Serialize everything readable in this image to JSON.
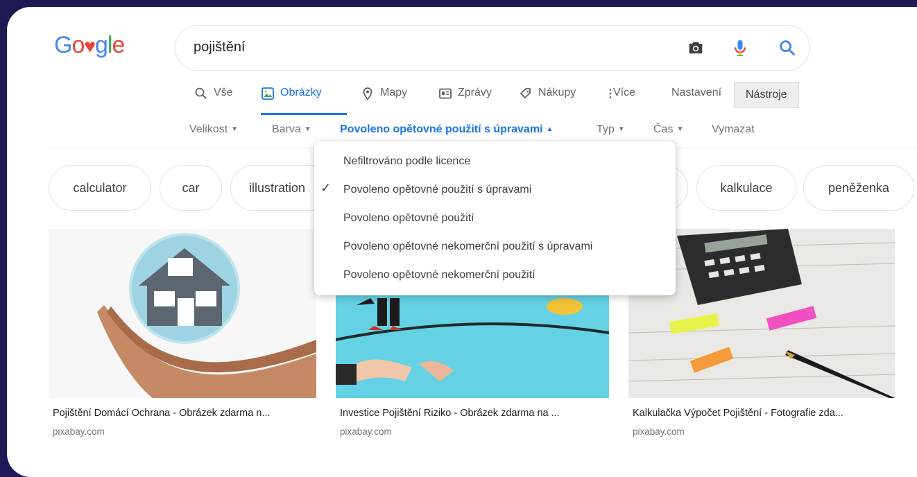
{
  "logo": {
    "letters": [
      "G",
      "o",
      "gle"
    ]
  },
  "search": {
    "query": "pojištění"
  },
  "tabs": [
    {
      "label": "Vše"
    },
    {
      "label": "Obrázky"
    },
    {
      "label": "Mapy"
    },
    {
      "label": "Zprávy"
    },
    {
      "label": "Nákupy"
    },
    {
      "label": "Více"
    },
    {
      "label": "Nastavení"
    },
    {
      "label": "Nástroje"
    }
  ],
  "filters": [
    {
      "label": "Velikost"
    },
    {
      "label": "Barva"
    },
    {
      "label": "Povoleno opětovné použití s úpravami"
    },
    {
      "label": "Typ"
    },
    {
      "label": "Čas"
    },
    {
      "label": "Vymazat"
    }
  ],
  "chips": [
    "calculator",
    "car",
    "illustration",
    "kalkulace",
    "peněženka"
  ],
  "dropdown": {
    "items": [
      "Nefiltrováno podle licence",
      "Povoleno opětovné použití s úpravami",
      "Povoleno opětovné použití",
      "Povoleno opětovné nekomerční použití s úpravami",
      "Povoleno opětovné nekomerční použití"
    ],
    "selected_index": 1
  },
  "results": [
    {
      "caption": "Pojištění Domácí Ochrana - Obrázek zdarma n...",
      "source": "pixabay.com"
    },
    {
      "caption": "Investice Pojištění Riziko - Obrázek zdarma na ...",
      "source": "pixabay.com"
    },
    {
      "caption": "Kalkulačka Výpočet Pojištění - Fotografie zda...",
      "source": "pixabay.com"
    }
  ],
  "colors": {
    "frame": "#1d1a56",
    "accent": "#1a73e8",
    "google_blue": "#4285f4",
    "google_red": "#ea4335",
    "google_yellow": "#fbbc05",
    "google_green": "#34a853"
  }
}
